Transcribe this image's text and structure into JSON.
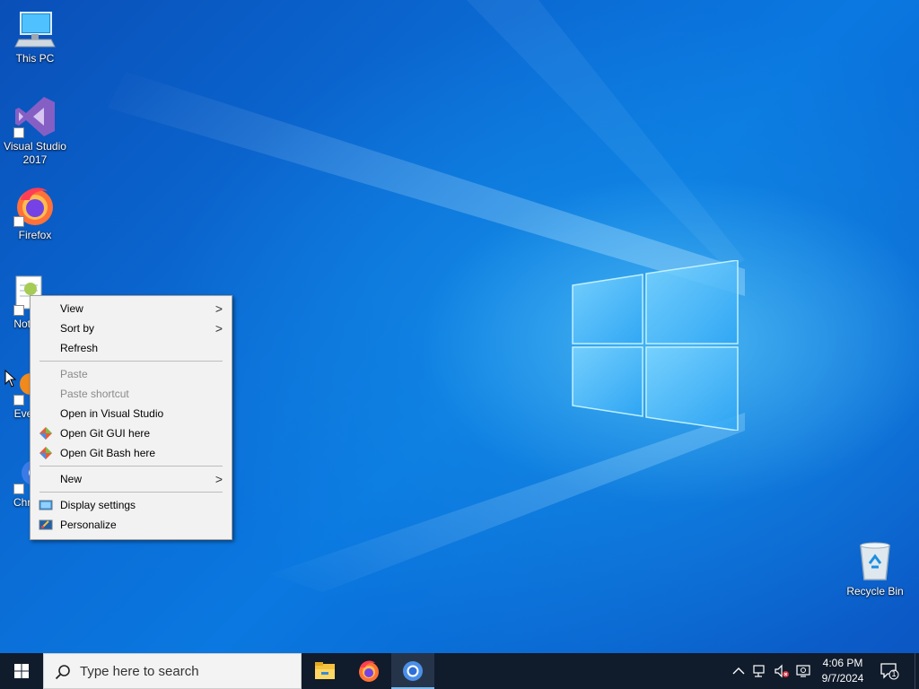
{
  "desktop": {
    "icons": [
      {
        "label": "This PC",
        "icon": "this-pc-icon"
      },
      {
        "label": "Visual Studio 2017",
        "icon": "visual-studio-icon"
      },
      {
        "label": "Firefox",
        "icon": "firefox-icon"
      },
      {
        "label": "Note",
        "icon": "notepad-icon"
      },
      {
        "label": "Ever",
        "icon": "everything-icon"
      },
      {
        "label": "Chro",
        "icon": "chrome-icon"
      },
      {
        "label": "Recycle Bin",
        "icon": "recycle-bin-icon"
      }
    ]
  },
  "context_menu": {
    "view": "View",
    "sort_by": "Sort by",
    "refresh": "Refresh",
    "paste": "Paste",
    "paste_shortcut": "Paste shortcut",
    "open_vs": "Open in Visual Studio",
    "open_git_gui": "Open Git GUI here",
    "open_git_bash": "Open Git Bash here",
    "new": "New",
    "display_settings": "Display settings",
    "personalize": "Personalize",
    "submenu_arrow": ">"
  },
  "taskbar": {
    "search_placeholder": "Type here to search",
    "apps": [
      "File Explorer",
      "Firefox",
      "Chromium"
    ],
    "clock_time": "4:06 PM",
    "clock_date": "9/7/2024",
    "notification_count": "1"
  },
  "colors": {
    "taskbar": "#101b2b",
    "menu_bg": "#f2f2f2",
    "accent": "#76b9ed"
  }
}
